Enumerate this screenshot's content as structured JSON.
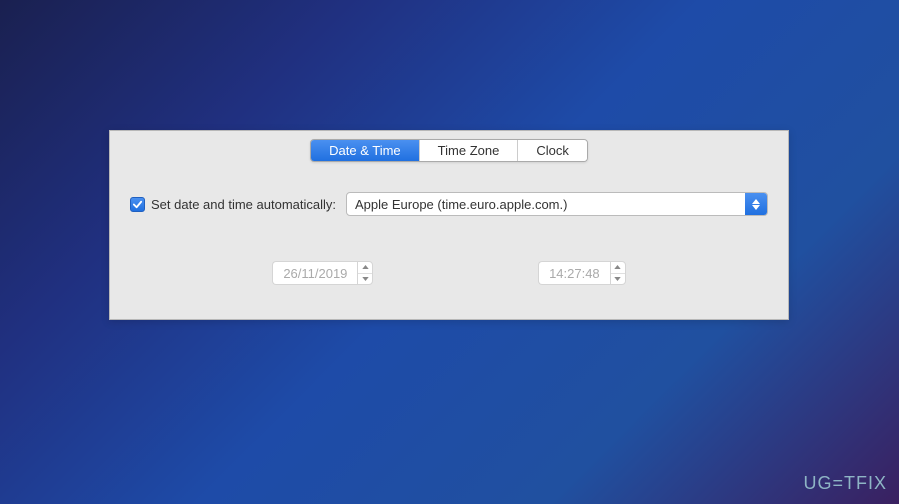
{
  "tabs": {
    "date_time": "Date & Time",
    "time_zone": "Time Zone",
    "clock": "Clock"
  },
  "auto_set": {
    "label": "Set date and time automatically:",
    "server": "Apple Europe (time.euro.apple.com.)"
  },
  "date_value": "26/11/2019",
  "time_value": "14:27:48",
  "watermark": "UG=TFIX"
}
